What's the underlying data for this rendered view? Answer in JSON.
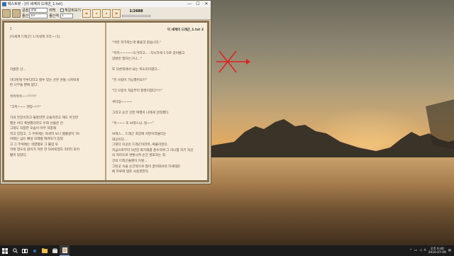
{
  "window": {
    "title": "텍스트뷰 - [이 세계의 드래곤_1.txt]",
    "minimize": "—",
    "maximize": "☐",
    "close": "✕"
  },
  "toolbar": {
    "font_label": "글꼴",
    "font_value": "굴림",
    "size_value": "10",
    "line_label": "줄간",
    "margin_label": "여백",
    "option_label": "책갈피보기",
    "option2_label": "줄간격",
    "page_select": "1",
    "page_info": "1/2688",
    "nav_first": "«",
    "nav_prev": "‹",
    "nav_next": "›",
    "nav_last": "»",
    "progress_fraction": 0.0
  },
  "book": {
    "left_page_number": "1",
    "right_header": "이 세계의 드래곤_1.txt  2",
    "left_lines": [
      "[이세계 드래곤] 1.이세계 거다~ (1)",
      "",
      "",
      "",
      "",
      "",
      "허름한 산...",
      "",
      "하다못해 무루다라고 할수 있는 산은 온통 시커먹게",
      "탄 나무들 뿐에 없다.",
      "",
      "쉬쉬쉬쉬~~!!!!!!!",
      "",
      "\"크흑~~~ 젠장~!!!\"",
      "",
      "거의 전장이라고 불할만한 곳들이라고 해도 이것만",
      "했은 어디 폭발했더라도 우와 산불은 안",
      "그래도 처참한 모습이 아주 처참해",
      "지고 있었고, 그 주위에는 자세히 보니 팸룡같이 70",
      "이태는 넘는 뼈성 모래뻥 화려하기 있었",
      "고 그 주위에는 색깔별로 그 뿔잠 또",
      "이렇 정도의 갈이가 이런 한 500미정도 5미터 되어",
      "뻗어 있었다."
    ],
    "right_lines": [
      "\"이런 젓가락는게 좋을것 같습니다.\"",
      "",
      "\"흑흑~~~~~오거라고.....지시하게 1:5로 장비볼고",
      "알렌번 필하는구나...\"",
      "",
      "또 다른쪽에서 내는 목소리이였다...",
      "",
      "\"전 사람이 가능했어요?!\"",
      "",
      "\"다 나중이 처음부터 잘못이었다!!!!\"",
      "",
      "쿠더덩~~~~",
      "",
      "그리고 순간 강한 여행이 나에게 강타했다.",
      "",
      "\"흑~~~ 또 브레스냐..컷~~\"",
      "",
      "브레스... 드래곤 최강에 어떤이라불리는",
      "대공이다...",
      "그렇다 이곳은 드래곤이라저..써울이었다.",
      "지금으로부터 5년전 화가해를 총수하여 그 이니를 자기 자신",
      "의 처리으로 변환시켜 순간 발포하는 최",
      "강의 드래곤플랜이 이렇...",
      "그런곳 속을 순간적으로 많이 끌어와서의 하게테문",
      "에 하루에 몇로 사용못한다."
    ]
  },
  "taskbar": {
    "start_icon": "windows-icon",
    "time": "오후 6:40",
    "date": "2016-07-09",
    "lang": "A",
    "items": [
      "search",
      "task-view",
      "edge",
      "explorer",
      "store",
      "viewer"
    ]
  }
}
